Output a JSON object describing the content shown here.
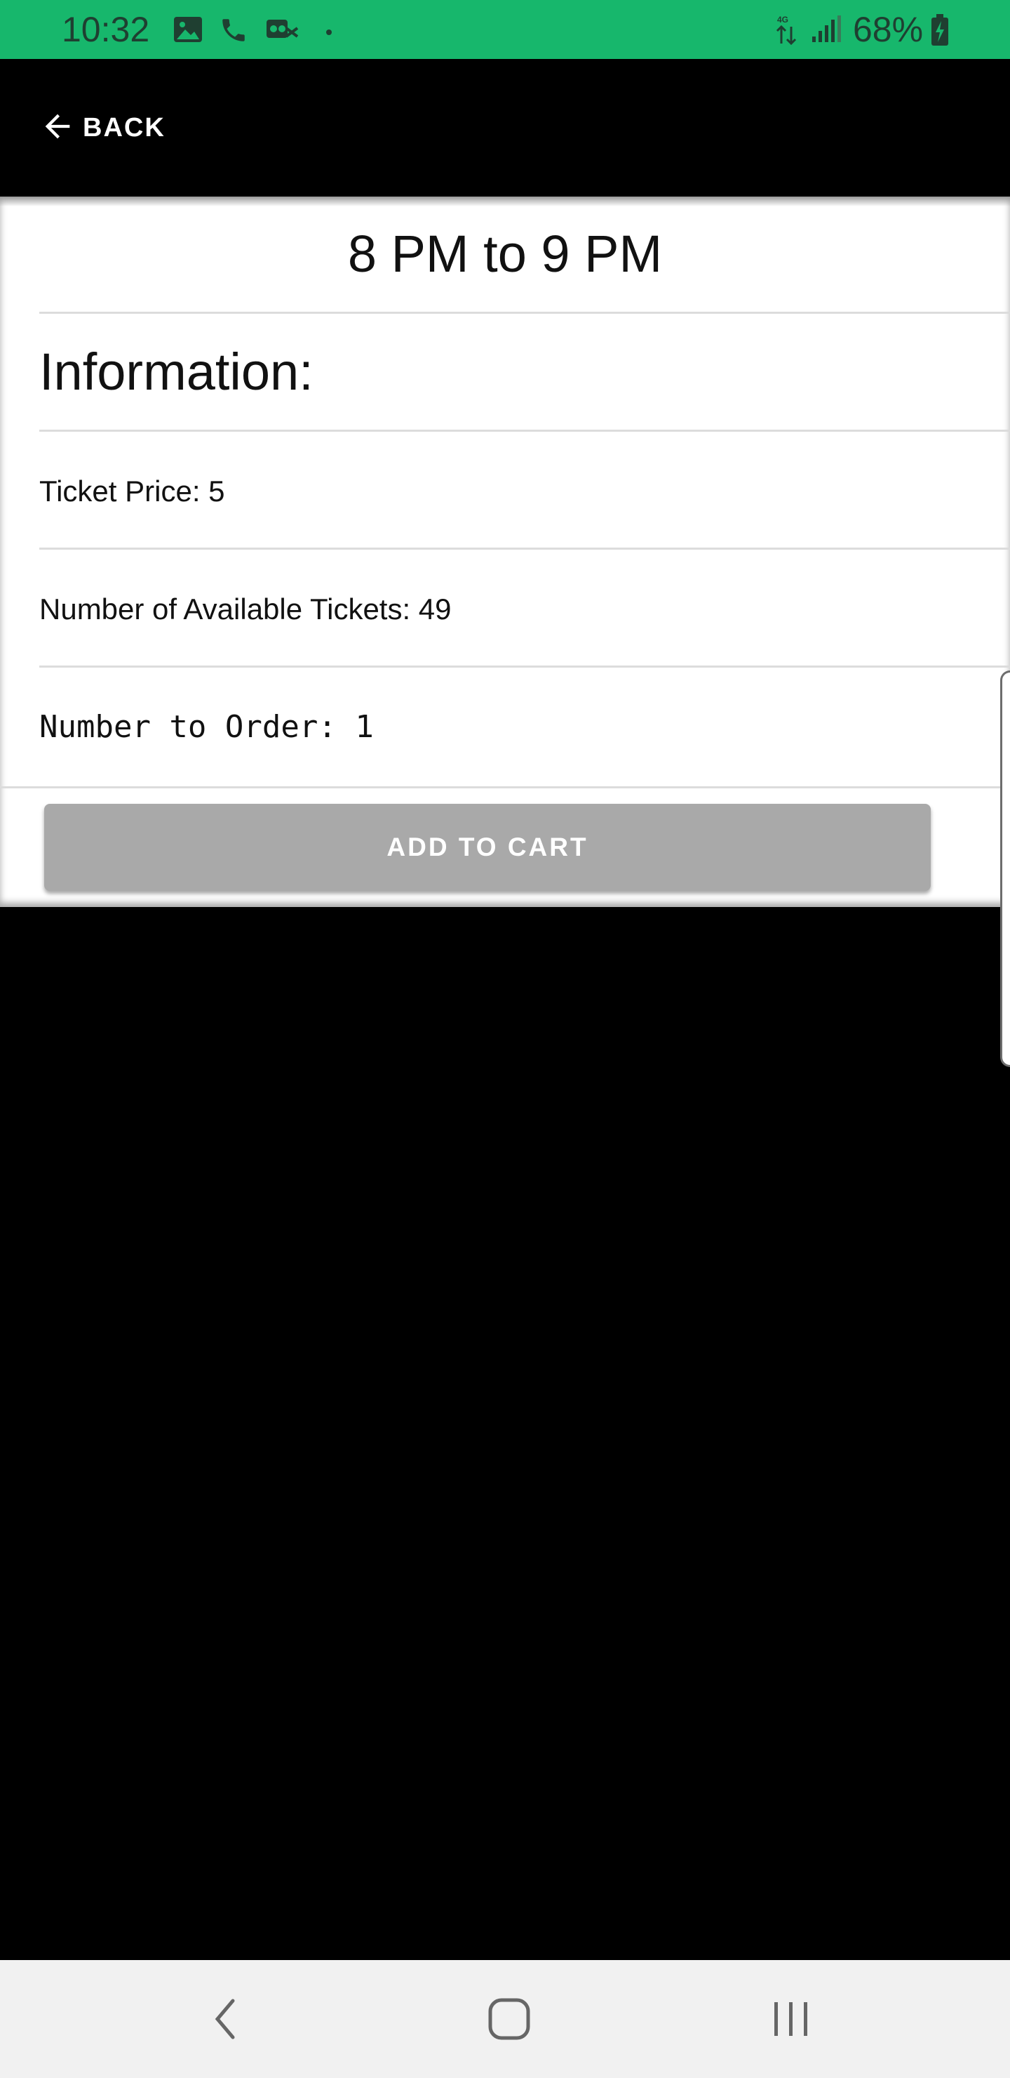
{
  "status_bar": {
    "time": "10:32",
    "battery_percent": "68%",
    "background_color": "#17b76c",
    "icons": [
      "gallery-icon",
      "phone-icon",
      "voicemail-icon",
      "dot-icon",
      "data-transfer-icon",
      "signal-icon",
      "battery-charging-icon"
    ]
  },
  "app_bar": {
    "back_label": "BACK"
  },
  "detail": {
    "title": "8 PM to 9 PM",
    "section_heading": "Information:",
    "ticket_price_text": "Ticket Price: 5",
    "available_tickets_text": "Number of Available Tickets: 49",
    "number_to_order_text": "Number to Order: 1"
  },
  "actions": {
    "add_to_cart_label": "ADD TO CART",
    "button_color": "#a9a9a9"
  },
  "nav_bar": {
    "buttons": [
      "back-nav-icon",
      "home-nav-icon",
      "recents-nav-icon"
    ]
  }
}
